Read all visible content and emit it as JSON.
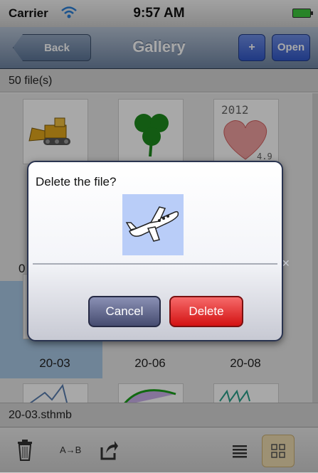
{
  "status_bar": {
    "carrier": "Carrier",
    "time": "9:57 AM",
    "wifi_icon": "wifi-icon",
    "battery_icon": "battery-icon"
  },
  "nav": {
    "back_label": "Back",
    "title": "Gallery",
    "plus_label": "+",
    "open_label": "Open",
    "accent": "#3d63cf"
  },
  "count_label": "50 file(s)",
  "grid": {
    "items": [
      {
        "label": "",
        "thumb": "bulldozer"
      },
      {
        "label": "",
        "thumb": "clover"
      },
      {
        "label": "",
        "thumb": "heart-2012"
      },
      {
        "label": "20-03",
        "thumb": "airplane",
        "selected": true
      },
      {
        "label": "20-06",
        "thumb": "drawing"
      },
      {
        "label": "20-08",
        "thumb": "drawing"
      },
      {
        "label": "",
        "thumb": "sketch-blue"
      },
      {
        "label": "",
        "thumb": "sketch-green"
      },
      {
        "label": "",
        "thumb": "sketch-teal"
      }
    ],
    "partial_label": "0"
  },
  "selected_file": "20-03.sthmb",
  "alert": {
    "title": "Delete the file?",
    "cancel_label": "Cancel",
    "delete_label": "Delete",
    "image": "airplane-drawing"
  },
  "toolbar": {
    "trash_icon": "trash-icon",
    "rename_label": "A→B",
    "share_icon": "share-icon",
    "list_icon": "list-icon",
    "grid_icon": "grid-icon"
  }
}
